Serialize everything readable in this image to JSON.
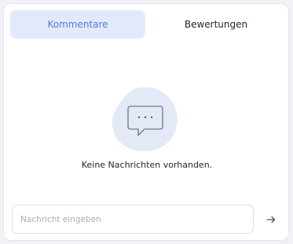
{
  "tabs": [
    {
      "label": "Kommentare",
      "active": true
    },
    {
      "label": "Bewertungen",
      "active": false
    }
  ],
  "empty_state": {
    "icon": "chat-bubble-icon",
    "message": "Keine Nachrichten vorhanden."
  },
  "composer": {
    "placeholder": "Nachricht eingeben",
    "value": "",
    "send_icon": "arrow-right-icon"
  },
  "colors": {
    "accent": "#5878e0",
    "tab_active_bg": "#e3e9fb",
    "blob": "#e4e9f7"
  }
}
